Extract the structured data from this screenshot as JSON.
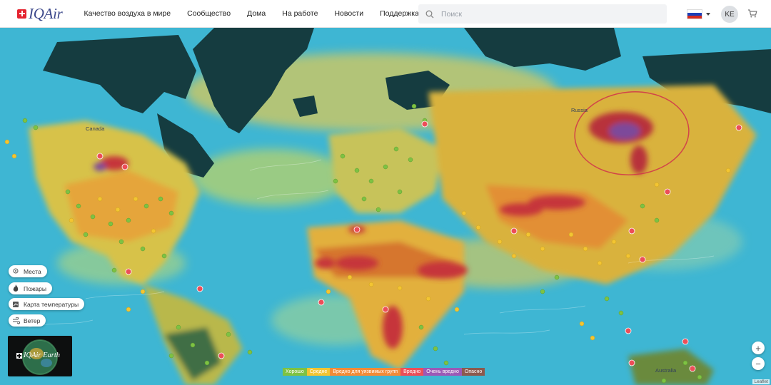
{
  "header": {
    "logo_text": "IQAir",
    "nav": [
      "Качество воздуха в мире",
      "Сообщество",
      "Дома",
      "На работе",
      "Новости",
      "Поддержка"
    ],
    "search_placeholder": "Поиск",
    "language": "Русский",
    "avatar_initials": "KE",
    "icons": [
      "search-icon",
      "cart-icon",
      "chevron-down-icon"
    ]
  },
  "map": {
    "labels": {
      "canada": "Canada",
      "russia": "Russia",
      "australia": "Australia"
    },
    "layers": [
      {
        "label": "Места",
        "icon": "pin-icon"
      },
      {
        "label": "Пожары",
        "icon": "fire-icon"
      },
      {
        "label": "Карта температуры",
        "icon": "thermometer-map-icon"
      },
      {
        "label": "Ветер",
        "icon": "wind-icon"
      }
    ],
    "earth_button": "IQAir Earth",
    "zoom": {
      "in": "+",
      "out": "−"
    },
    "attribution": "Leaflet",
    "legend": [
      {
        "label": "Хорошо",
        "color": "#7ec243"
      },
      {
        "label": "Средне",
        "color": "#f3c532"
      },
      {
        "label": "Вредно для уязвимых групп",
        "color": "#f38b37"
      },
      {
        "label": "Вредно",
        "color": "#ec4e58"
      },
      {
        "label": "Очень вредно",
        "color": "#9b59b6"
      },
      {
        "label": "Опасно",
        "color": "#8c5a4e"
      }
    ]
  },
  "colors": {
    "ocean": "#3eb6d3",
    "land_dark": "#153c40",
    "good": "#7ec243",
    "moderate": "#e8c23a",
    "unhealthy": "#c6363a",
    "very_unhealthy": "#7d4a9a",
    "highlight_circle": "#d0384a"
  }
}
